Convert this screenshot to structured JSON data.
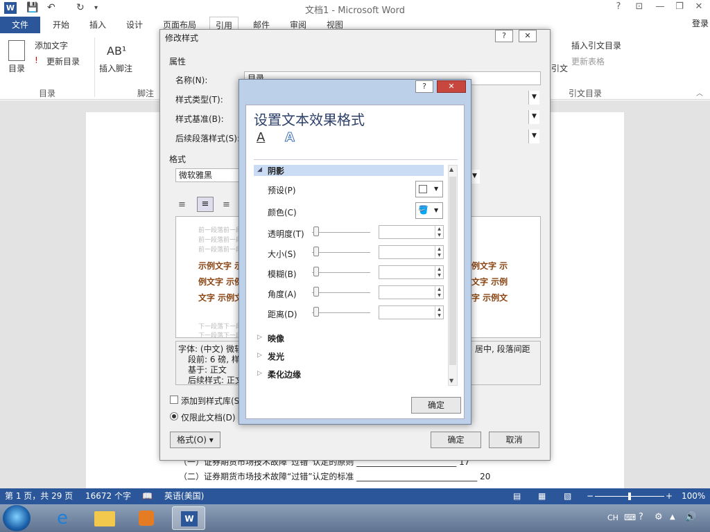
{
  "window": {
    "title": "文档1 - Microsoft Word",
    "controls": [
      "?",
      "⊡",
      "—",
      "❐",
      "✕"
    ]
  },
  "ribbon": {
    "tabs": [
      "文件",
      "开始",
      "插入",
      "设计",
      "页面布局",
      "引用",
      "邮件",
      "审阅",
      "视图"
    ],
    "active_tab": "引用",
    "account": "登录",
    "toc": {
      "button": "目录",
      "add_text": "添加文字",
      "update": "更新目录",
      "group": "目录"
    },
    "footnotes": {
      "insert": "插入脚注",
      "group": "脚注"
    },
    "captions": {
      "insert_tof": "插入引文目录",
      "update_table": "更新表格",
      "group": "引文目录",
      "citation": "引文"
    }
  },
  "document": {
    "line1": "（一）证券期货市场技术故障“过错”认定的原则 ________________________ 17",
    "line2": "（二）证券期货市场技术故障“过错”认定的标准 _____________________________ 20"
  },
  "status": {
    "page": "第 1 页，共 29 页",
    "words": "16672 个字",
    "language": "英语(美国)",
    "zoom": "100%",
    "zoom_level_percent": 100
  },
  "tray": {
    "ime": "CH"
  },
  "modify_style": {
    "title": "修改样式",
    "properties": "属性",
    "name_label": "名称(N):",
    "name_value": "目录",
    "type_label": "样式类型(T):",
    "based_label": "样式基准(B):",
    "next_label": "后续段落样式(S):",
    "format_section": "格式",
    "font": "微软雅黑",
    "preview_prev": "前一段落前一段落前一段落前一段落前一段落前一段落前一段落",
    "preview_sample1": "示例文字 示",
    "preview_sample2": "例文字 示例",
    "preview_sample3": "文字 示例文",
    "preview_sample_r1": "例文字 示",
    "preview_sample_r2": "文字 示例",
    "preview_sample_r3": "字 示例文",
    "preview_next": "下一段落下一段落下一段落下一段落下一段落下一段落下一段落",
    "desc_line1": "字体: (中文) 微软",
    "desc_line1_right": "居中, 段落间距",
    "desc_line2": "段前: 6 磅, 样",
    "desc_line3": "基于: 正文",
    "desc_line4": "后续样式: 正文",
    "add_to_gallery": "添加到样式库(S)",
    "only_this_doc": "仅限此文档(D)",
    "format_button": "格式(O) ▾",
    "ok": "确定",
    "cancel": "取消"
  },
  "text_effects": {
    "title": "设置文本效果格式",
    "tab_fill": "A",
    "tab_effects": "A",
    "section_shadow": "阴影",
    "preset": "预设(P)",
    "color": "颜色(C)",
    "transparency": "透明度(T)",
    "size": "大小(S)",
    "blur": "模糊(B)",
    "angle": "角度(A)",
    "distance": "距离(D)",
    "reflection": "映像",
    "glow": "发光",
    "soft_edges": "柔化边缘",
    "ok": "确定"
  },
  "colors": {
    "accent": "#2b579a",
    "sample_text": "#8b4513"
  }
}
